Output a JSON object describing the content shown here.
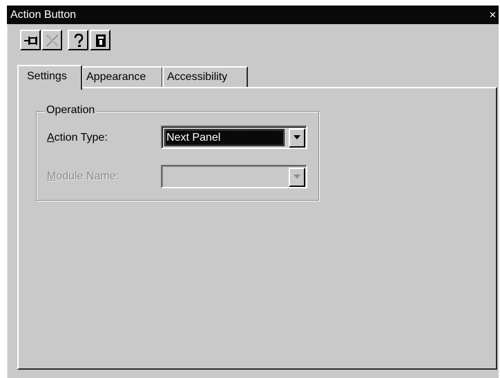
{
  "window": {
    "title": "Action Button"
  },
  "titlebar": {
    "close_icon": "close-icon"
  },
  "toolbar": {
    "buttons": [
      {
        "name": "pin-icon"
      },
      {
        "name": "delete-icon",
        "disabled": true
      },
      {
        "name": "help-icon"
      },
      {
        "name": "properties-icon"
      }
    ]
  },
  "tabs": [
    {
      "label": "Settings",
      "active": true
    },
    {
      "label": "Appearance",
      "active": false
    },
    {
      "label": "Accessibility",
      "active": false
    }
  ],
  "operation": {
    "group_label": "Operation",
    "action_type": {
      "label_underlined": "A",
      "label_rest": "ction Type:",
      "value": "Next Panel"
    },
    "module_name": {
      "label_underlined": "M",
      "label_rest": "odule Name:",
      "value": "",
      "disabled": true
    }
  },
  "colors": {
    "window_bg": "#c9c9c9",
    "titlebar_bg": "#0a0a0a",
    "selection_bg": "#0a0a0a",
    "disabled_text": "#8d8d8d"
  }
}
